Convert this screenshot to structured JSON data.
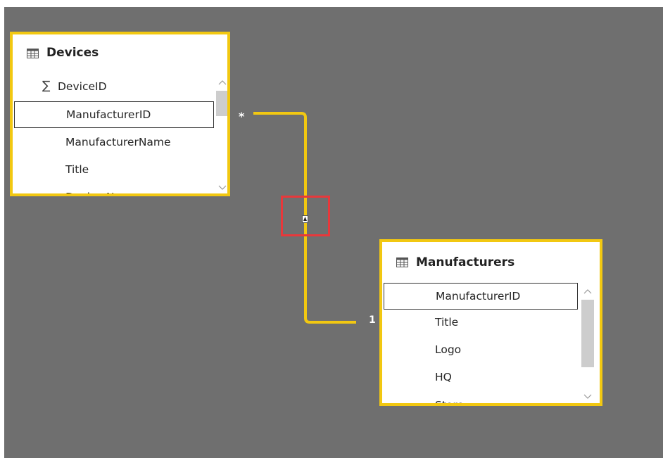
{
  "colors": {
    "canvas_background": "#6f6f6f",
    "table_border": "#f2c811",
    "relationship_line": "#f2c811",
    "highlight": "#e8383b"
  },
  "devices_table": {
    "title": "Devices",
    "icon": "table-icon",
    "fields": [
      {
        "label": "DeviceID",
        "icon": "sigma-icon",
        "selected": false
      },
      {
        "label": "ManufacturerID",
        "selected": true
      },
      {
        "label": "ManufacturerName",
        "selected": false
      },
      {
        "label": "Title",
        "selected": false
      },
      {
        "label": "Device Name",
        "selected": false
      }
    ]
  },
  "manufacturers_table": {
    "title": "Manufacturers",
    "icon": "table-icon",
    "fields": [
      {
        "label": "ManufacturerID",
        "selected": true
      },
      {
        "label": "Title",
        "selected": false
      },
      {
        "label": "Logo",
        "selected": false
      },
      {
        "label": "HQ",
        "selected": false
      },
      {
        "label": "Store",
        "selected": false
      }
    ]
  },
  "relationship": {
    "from_table": "Devices",
    "from_cardinality": "*",
    "to_table": "Manufacturers",
    "to_cardinality": "1",
    "filter_direction_icon": "single-direction-arrow-icon"
  }
}
